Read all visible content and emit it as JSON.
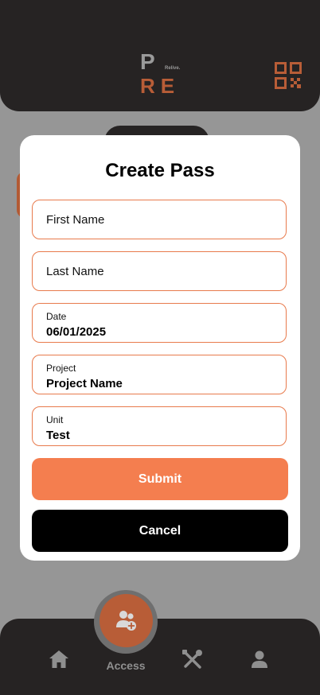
{
  "header": {
    "logo": {
      "letter_top": "P",
      "tagline": "Relive.",
      "letters_bottom": "RE"
    },
    "qr_icon": "qr-code-icon"
  },
  "modal": {
    "title": "Create Pass",
    "fields": {
      "first_name": {
        "placeholder": "First Name",
        "value": ""
      },
      "last_name": {
        "placeholder": "Last Name",
        "value": ""
      },
      "date": {
        "label": "Date",
        "value": "06/01/2025"
      },
      "project": {
        "label": "Project",
        "value": "Project Name"
      },
      "unit": {
        "label": "Unit",
        "value": "Test"
      }
    },
    "submit_label": "Submit",
    "cancel_label": "Cancel"
  },
  "nav": {
    "items": [
      {
        "icon": "home-icon",
        "label": ""
      },
      {
        "icon": "user-add-icon",
        "label": "Access",
        "active": true
      },
      {
        "icon": "tools-icon",
        "label": ""
      },
      {
        "icon": "profile-icon",
        "label": ""
      }
    ]
  },
  "colors": {
    "accent": "#f47e4f",
    "brand_rust": "#b85d37",
    "dark": "#262323",
    "overlay": "#969696",
    "field_border": "#e87a4c"
  }
}
